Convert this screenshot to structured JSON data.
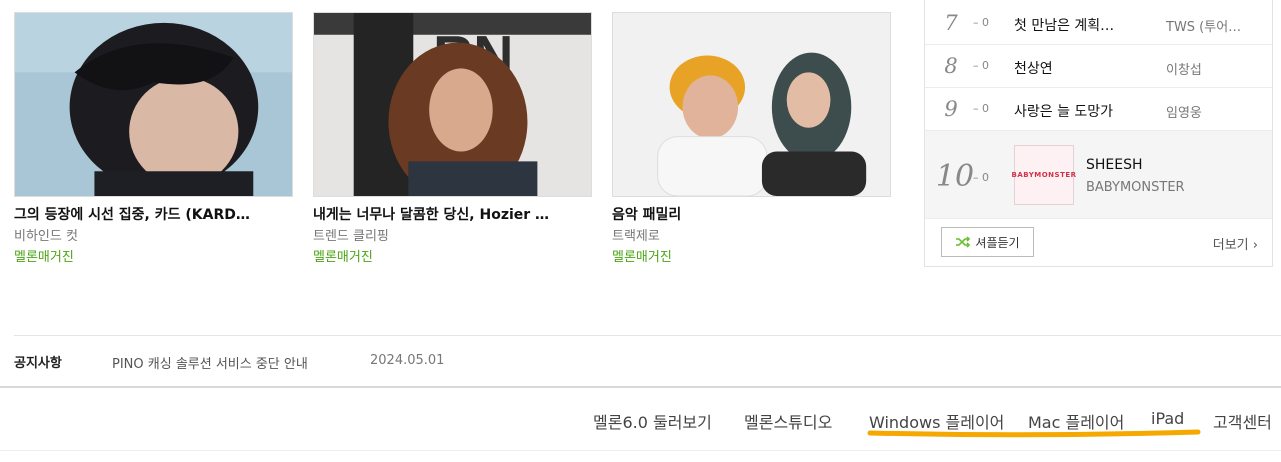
{
  "articles": [
    {
      "title": "그의 등장에 시선 집중, 카드 (KARD…",
      "category": "비하인드 컷",
      "source": "멜론매거진"
    },
    {
      "title": "내게는 너무나 달콤한 당신, Hozier …",
      "category": "트렌드 클리핑",
      "source": "멜론매거진"
    },
    {
      "title": "음악 패밀리",
      "category": "트랙제로",
      "source": "멜론매거진"
    }
  ],
  "chart": {
    "rows": [
      {
        "rank": "7",
        "change": "0",
        "song": "첫 만남은 계획…",
        "artist": "TWS (투어…"
      },
      {
        "rank": "8",
        "change": "0",
        "song": "천상연",
        "artist": "이창섭"
      },
      {
        "rank": "9",
        "change": "0",
        "song": "사랑은 늘 도망가",
        "artist": "임영웅"
      }
    ],
    "featured": {
      "rank": "10",
      "change": "0",
      "song": "SHEESH",
      "artist": "BABYMONSTER",
      "cover_text": "BABYMONSTER"
    },
    "shuffle_label": "셔플듣기",
    "more_label": "더보기"
  },
  "notice": {
    "label": "공지사항",
    "text": "PINO 캐싱 솔루션 서비스 중단 안내",
    "date": "2024.05.01"
  },
  "footer": {
    "links": [
      "멜론6.0 둘러보기",
      "멜론스튜디오",
      "Windows 플레이어",
      "Mac 플레이어",
      "iPad",
      "고객센터"
    ],
    "highlight_color": "#f5a800"
  },
  "colors": {
    "accent_green": "#4ba414"
  }
}
